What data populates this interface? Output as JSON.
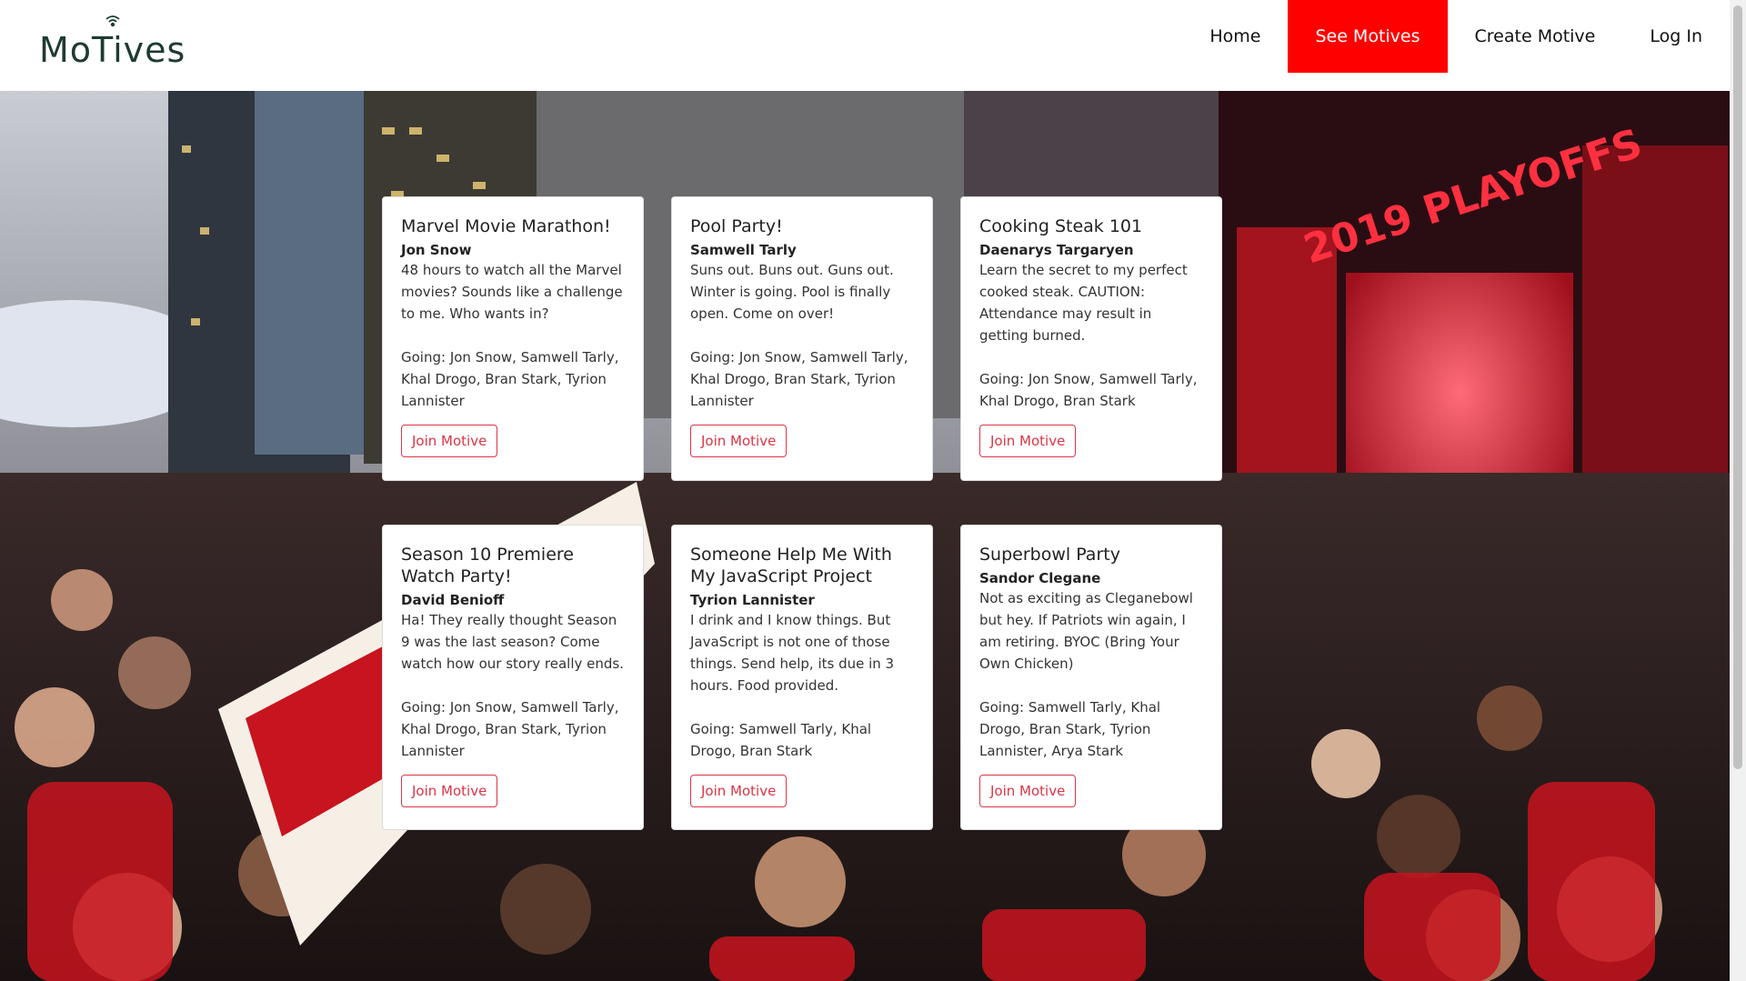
{
  "brand": {
    "logo_text": "MoTives"
  },
  "nav": {
    "items": [
      {
        "label": "Home",
        "active": false
      },
      {
        "label": "See Motives",
        "active": true
      },
      {
        "label": "Create Motive",
        "active": false
      },
      {
        "label": "Log In",
        "active": false
      }
    ]
  },
  "theme": {
    "accent": "#ff0000",
    "button_color": "#dc3545",
    "logo_color": "#1e3b33"
  },
  "motives": [
    {
      "title": "Marvel Movie Marathon!",
      "host": "Jon Snow",
      "description": "48 hours to watch all the Marvel movies? Sounds like a challenge to me. Who wants in?",
      "going": "Going: Jon Snow, Samwell Tarly, Khal Drogo, Bran Stark, Tyrion Lannister",
      "button": "Join Motive"
    },
    {
      "title": "Pool Party!",
      "host": "Samwell Tarly",
      "description": "Suns out. Buns out. Guns out. Winter is going. Pool is finally open. Come on over!",
      "going": "Going: Jon Snow, Samwell Tarly, Khal Drogo, Bran Stark, Tyrion Lannister",
      "button": "Join Motive"
    },
    {
      "title": "Cooking Steak 101",
      "host": "Daenarys Targaryen",
      "description": "Learn the secret to my perfect cooked steak. CAUTION: Attendance may result in getting burned.",
      "going": "Going: Jon Snow, Samwell Tarly, Khal Drogo, Bran Stark",
      "button": "Join Motive"
    },
    {
      "title": "Season 10 Premiere Watch Party!",
      "host": "David Benioff",
      "description": "Ha! They really thought Season 9 was the last season? Come watch how our story really ends.",
      "going": "Going: Jon Snow, Samwell Tarly, Khal Drogo, Bran Stark, Tyrion Lannister",
      "button": "Join Motive"
    },
    {
      "title": "Someone Help Me With My JavaScript Project",
      "host": "Tyrion Lannister",
      "description": "I drink and I know things. But JavaScript is not one of those things. Send help, its due in 3 hours. Food provided.",
      "going": "Going: Samwell Tarly, Khal Drogo, Bran Stark",
      "button": "Join Motive"
    },
    {
      "title": "Superbowl Party",
      "host": "Sandor Clegane",
      "description": "Not as exciting as Cleganebowl but hey. If Patriots win again, I am retiring. BYOC (Bring Your Own Chicken)",
      "going": "Going: Samwell Tarly, Khal Drogo, Bran Stark, Tyrion Lannister, Arya Stark",
      "button": "Join Motive"
    }
  ],
  "hero": {
    "image": "crowd-photo",
    "sign_text": "2019 PLAYOFFS"
  }
}
